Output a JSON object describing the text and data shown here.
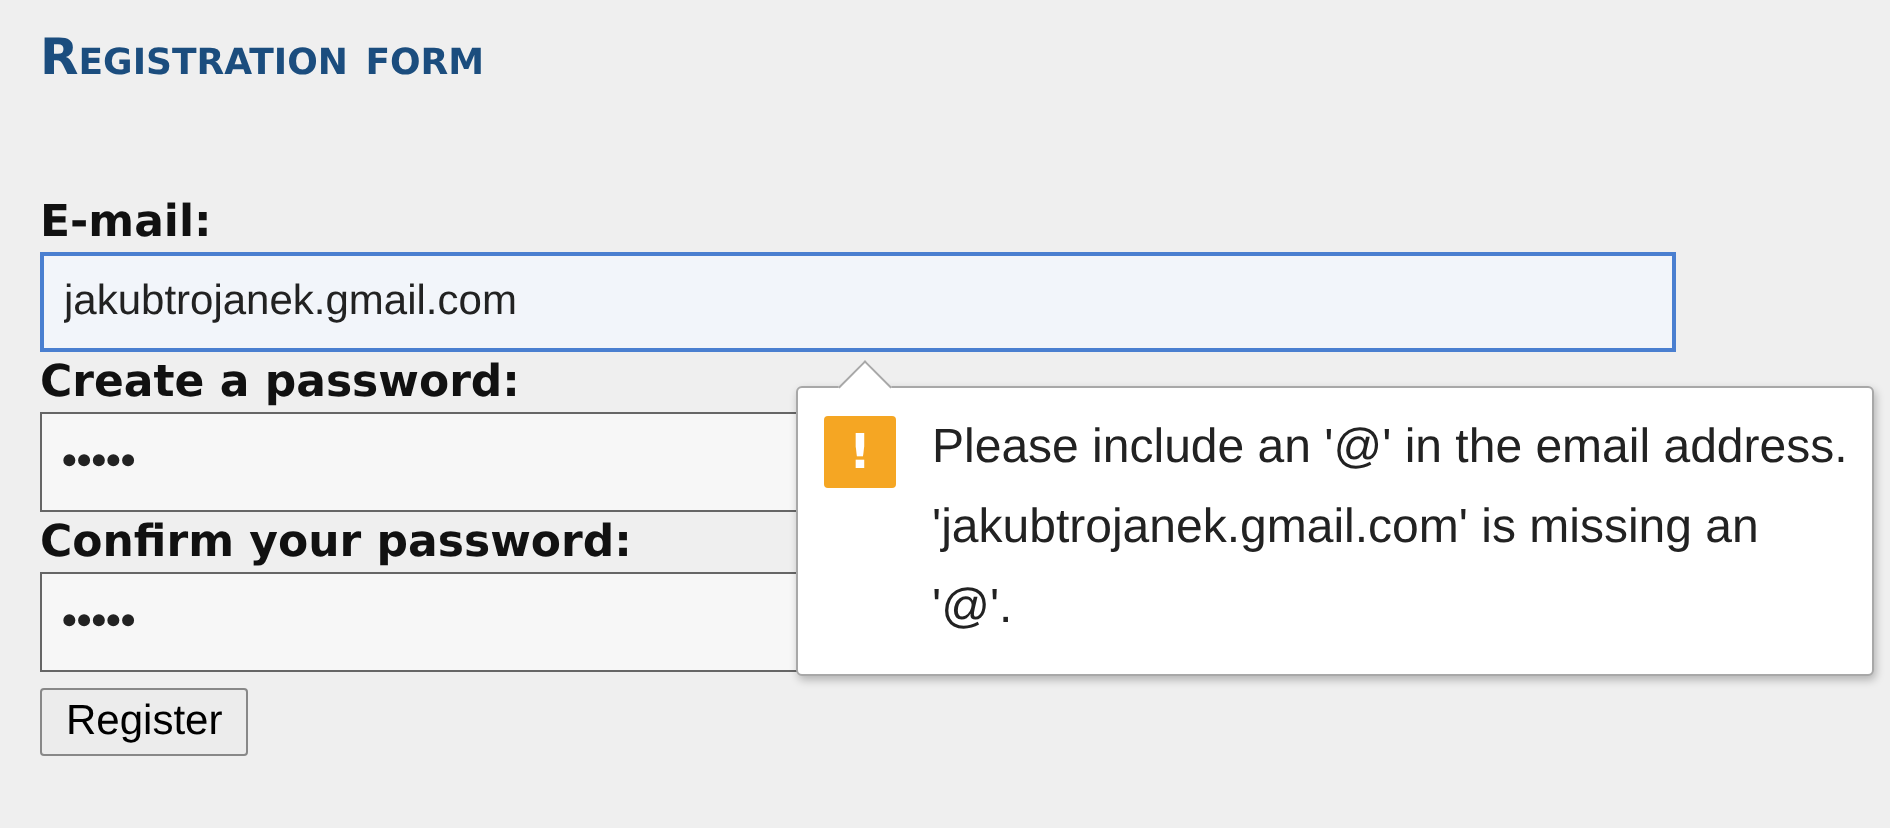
{
  "title": "Registration form",
  "fields": [
    {
      "label": "E-mail:",
      "value": "jakubtrojanek.gmail.com",
      "focused": true
    },
    {
      "label": "Create a password:",
      "value": "•••••",
      "focused": false
    },
    {
      "label": "Confirm your password:",
      "value": "•••••",
      "focused": false
    }
  ],
  "submit_button": "Register",
  "tooltip": {
    "icon": "!",
    "message": "Please include an '@' in the email address. 'jakubtrojanek.gmail.com' is missing an '@'."
  }
}
